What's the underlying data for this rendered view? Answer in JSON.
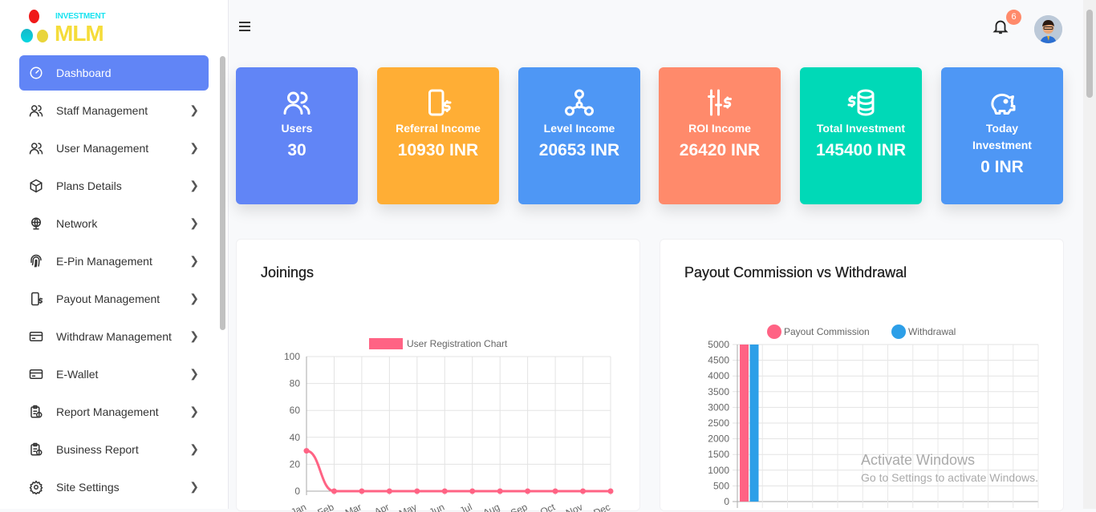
{
  "logo": {
    "top": "INVESTMENT",
    "main": "MLM"
  },
  "sidebar": {
    "items": [
      {
        "label": "Dashboard",
        "icon": "dashboard-icon",
        "active": true
      },
      {
        "label": "Staff Management",
        "icon": "users-icon"
      },
      {
        "label": "User Management",
        "icon": "users-icon"
      },
      {
        "label": "Plans Details",
        "icon": "box-icon"
      },
      {
        "label": "Network",
        "icon": "globe-icon"
      },
      {
        "label": "E-Pin Management",
        "icon": "fingerprint-icon"
      },
      {
        "label": "Payout Management",
        "icon": "mobile-dollar-icon"
      },
      {
        "label": "Withdraw Management",
        "icon": "card-icon"
      },
      {
        "label": "E-Wallet",
        "icon": "card-icon"
      },
      {
        "label": "Report Management",
        "icon": "report-icon"
      },
      {
        "label": "Business Report",
        "icon": "report-icon"
      },
      {
        "label": "Site Settings",
        "icon": "gear-icon"
      }
    ]
  },
  "header": {
    "notification_count": "6"
  },
  "cards": [
    {
      "label": "Users",
      "value": "30",
      "color": "#6185f6",
      "icon": "users-icon"
    },
    {
      "label": "Referral Income",
      "value": "10930 INR",
      "color": "#ffae35",
      "icon": "mobile-dollar-icon"
    },
    {
      "label": "Level Income",
      "value": "20653 INR",
      "color": "#4e97f5",
      "icon": "network-icon"
    },
    {
      "label": "ROI Income",
      "value": "26420 INR",
      "color": "#ff8a6b",
      "icon": "sliders-dollar-icon"
    },
    {
      "label": "Total Investment",
      "value": "145400 INR",
      "color": "#00d9b7",
      "icon": "coins-icon"
    },
    {
      "label": "Today Investment",
      "value": "0 INR",
      "color": "#4e97f5",
      "icon": "piggy-bank-icon"
    }
  ],
  "panels": {
    "joinings": "Joinings",
    "payout": "Payout Commission vs Withdrawal"
  },
  "chart_data": [
    {
      "type": "line",
      "title": "",
      "legend": [
        "User Registration Chart"
      ],
      "categories": [
        "Jan",
        "Feb",
        "Mar",
        "Apr",
        "May",
        "Jun",
        "Jul",
        "Aug",
        "Sep",
        "Oct",
        "Nov",
        "Dec"
      ],
      "series": [
        {
          "name": "User Registration Chart",
          "values": [
            30,
            0,
            0,
            0,
            0,
            0,
            0,
            0,
            0,
            0,
            0,
            0
          ],
          "color": "#ff6384"
        }
      ],
      "ylim": [
        0,
        100
      ],
      "yticks": [
        "100",
        "80",
        "60",
        "40",
        "20",
        "0"
      ],
      "grid": true,
      "legend_placement": "top"
    },
    {
      "type": "bar",
      "title": "",
      "legend": [
        "Payout Commission",
        "Withdrawal"
      ],
      "series": [
        {
          "name": "Payout Commission",
          "values": [
            5000,
            0,
            0,
            0,
            0,
            0,
            0,
            0,
            0,
            0,
            0,
            0
          ],
          "color": "#ff6384"
        },
        {
          "name": "Withdrawal",
          "values": [
            5000,
            0,
            0,
            0,
            0,
            0,
            0,
            0,
            0,
            0,
            0,
            0
          ],
          "color": "#2d9fe8"
        }
      ],
      "ylim": [
        0,
        5000
      ],
      "yticks": [
        "5000",
        "4500",
        "4000",
        "3500",
        "3000",
        "2500",
        "2000",
        "1500",
        "1000",
        "500",
        "0"
      ],
      "grid": true,
      "legend_placement": "top"
    }
  ],
  "watermark": {
    "line1": "Activate Windows",
    "line2": "Go to Settings to activate Windows."
  }
}
